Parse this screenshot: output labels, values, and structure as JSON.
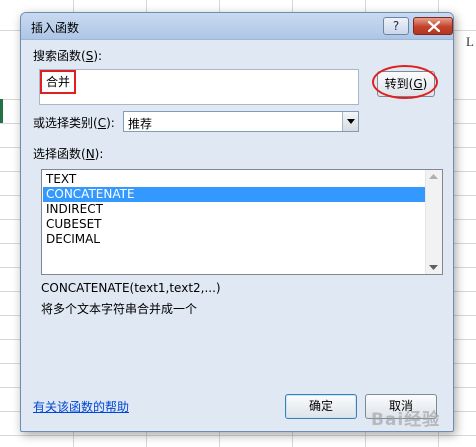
{
  "sheet": {
    "column_letter": "L"
  },
  "dialog": {
    "title": "插入函数",
    "help_glyph": "?",
    "search_label": "搜索函数(",
    "search_key": "S",
    "search_label_end": "):",
    "search_value": "合并",
    "goto_label": "转到(",
    "goto_key": "G",
    "goto_label_end": ")",
    "category_label": "或选择类别(",
    "category_key": "C",
    "category_label_end": "):",
    "category_value": "推荐",
    "function_label": "选择函数(",
    "function_key": "N",
    "function_label_end": "):",
    "functions": [
      "TEXT",
      "CONCATENATE",
      "INDIRECT",
      "CUBESET",
      "DECIMAL"
    ],
    "selected_function": "CONCATENATE",
    "signature": "CONCATENATE(text1,text2,...)",
    "description": "将多个文本字符串合并成一个",
    "help_link": "有关该函数的帮助",
    "ok_label": "确定",
    "cancel_label": "取消",
    "watermark": "Bai经验"
  },
  "colors": {
    "highlight": "#3399ff",
    "annotation_red": "#e02020",
    "link": "#0046d5"
  }
}
